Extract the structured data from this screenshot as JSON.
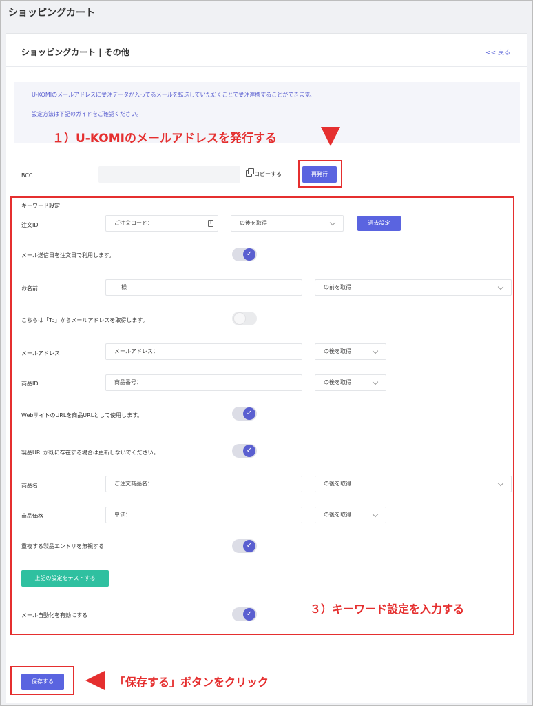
{
  "page": {
    "title": "ショッピングカート"
  },
  "card": {
    "title": "ショッピングカート | その他",
    "back_label": "<< 戻る"
  },
  "info": {
    "line1": "U-KOMIのメールアドレスに受注データが入ってるメールを転送していただくことで受注連携することができます。",
    "line2": "設定方法は下記のガイドをご確認ください。"
  },
  "annotations": {
    "step1": "１）U-KOMIのメールアドレスを発行する",
    "step3": "３）キーワード設定を入力する",
    "save_hint": "「保存する」ボタンをクリック"
  },
  "bcc": {
    "label": "BCC",
    "value": "",
    "copy_label": "コピーする",
    "reissue_label": "再発行"
  },
  "keywords": {
    "section_label": "キーワード設定",
    "order_id": {
      "label": "注文ID",
      "value": "ご注文コード：",
      "select": "の後を取得",
      "past_button": "過去設定"
    },
    "use_send_date": {
      "label": "メール送信日を注文日で利用します。",
      "on": true
    },
    "name": {
      "label": "お名前",
      "value": "様",
      "select": "の前を取得"
    },
    "use_to_email": {
      "label": "こちらは「To」からメールアドレスを取得します。",
      "on": false
    },
    "email": {
      "label": "メールアドレス",
      "value": "メールアドレス：",
      "select": "の後を取得"
    },
    "product_id": {
      "label": "商品ID",
      "value": "商品番号：",
      "select": "の後を取得"
    },
    "use_site_url": {
      "label": "WebサイトのURLを商品URLとして使用します。",
      "on": true
    },
    "no_update_url": {
      "label": "製品URLが既に存在する場合は更新しないでください。",
      "on": true
    },
    "product_name": {
      "label": "商品名",
      "value": "ご注文商品名：",
      "select": "の後を取得"
    },
    "product_price": {
      "label": "商品価格",
      "value": "単価：",
      "select": "の後を取得"
    },
    "ignore_dupes": {
      "label": "重複する製品エントリを無視する",
      "on": true
    },
    "test_button": "上記の設定をテストする",
    "enable_automation": {
      "label": "メール自動化を有効にする",
      "on": true
    }
  },
  "footer": {
    "save_label": "保存する"
  },
  "colors": {
    "accent": "#5a64e0",
    "teal": "#2fc0a0",
    "annotation_red": "#e52f2f"
  }
}
